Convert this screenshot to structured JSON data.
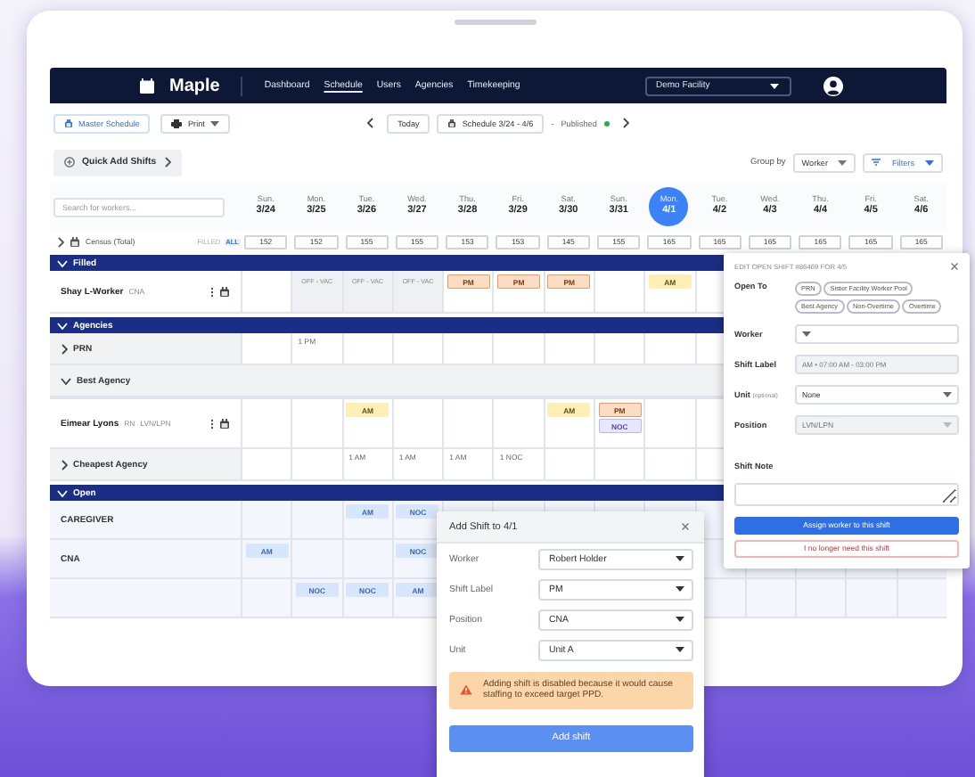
{
  "nav": {
    "logo": "Maple",
    "links": [
      {
        "label": "Dashboard",
        "selected": false
      },
      {
        "label": "Schedule",
        "selected": true
      },
      {
        "label": "Users",
        "selected": false
      },
      {
        "label": "Agencies",
        "selected": false
      },
      {
        "label": "Timekeeping",
        "selected": false
      }
    ],
    "facility": "Demo Facility"
  },
  "toolbar": {
    "master_schedule": "Master Schedule",
    "print": "Print",
    "today": "Today",
    "range": "Schedule 3/24 - 4/6",
    "status_dash": "-",
    "status": "Published"
  },
  "controls": {
    "quick_add": "Quick Add Shifts",
    "group_by_label": "Group by",
    "group_by": "Worker",
    "filters": "Filters"
  },
  "search": {
    "placeholder": "Search for workers..."
  },
  "days": [
    {
      "dow": "Sun.",
      "date": "3/24",
      "selected": false
    },
    {
      "dow": "Mon.",
      "date": "3/25",
      "selected": false
    },
    {
      "dow": "Tue.",
      "date": "3/26",
      "selected": false
    },
    {
      "dow": "Wed.",
      "date": "3/27",
      "selected": false
    },
    {
      "dow": "Thu.",
      "date": "3/28",
      "selected": false
    },
    {
      "dow": "Fri.",
      "date": "3/29",
      "selected": false
    },
    {
      "dow": "Sat.",
      "date": "3/30",
      "selected": false
    },
    {
      "dow": "Sun.",
      "date": "3/31",
      "selected": false
    },
    {
      "dow": "Mon.",
      "date": "4/1",
      "selected": true
    },
    {
      "dow": "Tue.",
      "date": "4/2",
      "selected": false
    },
    {
      "dow": "Wed.",
      "date": "4/3",
      "selected": false
    },
    {
      "dow": "Thu.",
      "date": "4/4",
      "selected": false
    },
    {
      "dow": "Fri.",
      "date": "4/5",
      "selected": false
    },
    {
      "dow": "Sat.",
      "date": "4/6",
      "selected": false
    }
  ],
  "census": {
    "label": "Census (Total)",
    "toggles": [
      {
        "label": "FILLED",
        "selected": false
      },
      {
        "label": "ALL",
        "selected": true
      }
    ],
    "values": [
      "152",
      "152",
      "155",
      "155",
      "153",
      "153",
      "145",
      "155",
      "165",
      "165",
      "165",
      "165",
      "165",
      "165"
    ]
  },
  "groups": [
    {
      "title": "Filled",
      "expanded": true,
      "rows": [
        {
          "kind": "worker",
          "name": "Shay L-Worker",
          "tags": [
            "CNA"
          ],
          "cells": [
            [],
            [
              {
                "label": "OFF - VAC",
                "kind": "off"
              }
            ],
            [
              {
                "label": "OFF - VAC",
                "kind": "off"
              }
            ],
            [
              {
                "label": "OFF - VAC",
                "kind": "off"
              }
            ],
            [
              {
                "label": "PM",
                "kind": "pm"
              }
            ],
            [
              {
                "label": "PM",
                "kind": "pm"
              }
            ],
            [
              {
                "label": "PM",
                "kind": "pm"
              }
            ],
            [],
            [
              {
                "label": "AM",
                "kind": "am"
              }
            ]
          ]
        }
      ]
    },
    {
      "title": "Agencies",
      "expanded": true,
      "rows": [
        {
          "kind": "agency",
          "name": "PRN",
          "expanded": false,
          "cells": [
            [],
            [
              {
                "label": "1 PM",
                "kind": "count"
              }
            ]
          ]
        },
        {
          "kind": "subgroup",
          "name": "Best Agency",
          "expanded": true
        },
        {
          "kind": "worker",
          "name": "Eimear Lyons",
          "tags": [
            "RN",
            "LVN/LPN"
          ],
          "cells": [
            [],
            [],
            [
              {
                "label": "AM",
                "kind": "am"
              }
            ],
            [],
            [],
            [],
            [
              {
                "label": "AM",
                "kind": "am"
              }
            ],
            [
              {
                "label": "PM",
                "kind": "pm"
              },
              {
                "label": "NOC",
                "kind": "noc"
              }
            ]
          ]
        },
        {
          "kind": "agency",
          "name": "Cheapest Agency",
          "expanded": false,
          "cells": [
            [],
            [],
            [
              {
                "label": "1 AM",
                "kind": "count"
              }
            ],
            [
              {
                "label": "1 AM",
                "kind": "count"
              }
            ],
            [
              {
                "label": "1 AM",
                "kind": "count"
              }
            ],
            [
              {
                "label": "1 NOC",
                "kind": "count"
              }
            ]
          ]
        }
      ]
    },
    {
      "title": "Open",
      "expanded": true,
      "rows": [
        {
          "kind": "role",
          "name": "CAREGIVER",
          "cells": [
            [],
            [],
            [
              {
                "label": "AM",
                "kind": "open"
              }
            ],
            [
              {
                "label": "NOC",
                "kind": "open"
              }
            ]
          ]
        },
        {
          "kind": "role",
          "name": "CNA",
          "cells": [
            [
              {
                "label": "AM",
                "kind": "open"
              }
            ],
            [],
            [],
            [
              {
                "label": "NOC",
                "kind": "open"
              }
            ]
          ]
        },
        {
          "kind": "role",
          "cells": [
            [],
            [
              {
                "label": "NOC",
                "kind": "open"
              }
            ],
            [
              {
                "label": "NOC",
                "kind": "open"
              }
            ],
            [
              {
                "label": "AM",
                "kind": "open"
              }
            ]
          ]
        }
      ]
    }
  ],
  "edit_panel": {
    "title": "EDIT OPEN SHIFT #86469 FOR 4/5",
    "open_to_label": "Open To",
    "open_to": [
      "PRN",
      "Sister Facility Worker Pool",
      "Best Agency",
      "Non-Overtime",
      "Overtime"
    ],
    "fields": [
      {
        "kind": "select",
        "label": "Worker",
        "disabled": false
      },
      {
        "kind": "text",
        "label": "Shift Label",
        "value": "AM • 07:00 AM - 03:00 PM",
        "disabled": true
      },
      {
        "kind": "select",
        "label": "Unit",
        "hint": "(optional)",
        "value": "None",
        "disabled": false
      },
      {
        "kind": "select",
        "label": "Position",
        "value": "LVN/LPN",
        "disabled": true
      },
      {
        "kind": "note",
        "label": "Shift Note"
      }
    ],
    "assign": "Assign worker to this shift",
    "remove": "I no longer need this shift"
  },
  "add_dialog": {
    "title": "Add Shift to 4/1",
    "fields": [
      {
        "label": "Worker",
        "value": "Robert Holder"
      },
      {
        "label": "Shift Label",
        "value": "PM"
      },
      {
        "label": "Position",
        "value": "CNA"
      },
      {
        "label": "Unit",
        "value": "Unit A"
      }
    ],
    "warning": "Adding shift is disabled because it would cause staffing to exceed target PPD.",
    "button": {
      "label": "Add shift",
      "disabled": true
    }
  }
}
